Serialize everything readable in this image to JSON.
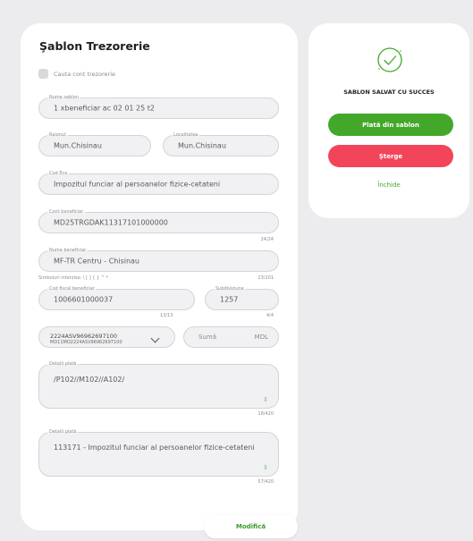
{
  "form": {
    "title": "Şablon Trezorerie",
    "checkbox_label": "Cauta cont trezorerie",
    "template_name": {
      "label": "Nume sablon",
      "value": "1 xbeneficiar ac 02 01 25 t2"
    },
    "raion": {
      "label": "Raionul",
      "value": "Mun.Chisinau"
    },
    "locality": {
      "label": "Localitatea",
      "value": "Mun.Chisinau"
    },
    "eco_code": {
      "label": "Cod Eco",
      "value": "Impozitul funciar al persoanelor fizice-cetateni"
    },
    "beneficiary_account": {
      "label": "Cont beneficiar",
      "value": "MD25TRGDAK11317101000000",
      "counter": "24/24"
    },
    "beneficiary_name": {
      "label": "Nume beneficiar",
      "value": "MF-TR Centru - Chisinau",
      "allowed_symbols": "Simboluri interzise: \\ [ ] { } ^ *",
      "counter": "23/101"
    },
    "fiscal_code": {
      "label": "Cod fiscal beneficiar",
      "value": "1006601000037",
      "counter": "13/13"
    },
    "subdivision": {
      "label": "Subdiviziune",
      "value": "1257",
      "counter": "4/4"
    },
    "payer_account": {
      "main": "2224ASV96962697100",
      "sub": "MD11MO2224ASV96962697100"
    },
    "amount": {
      "placeholder": "Sumă",
      "currency": "MDL"
    },
    "payment_details_1": {
      "label": "Detalii plată",
      "value": "/P102//M102//A102/",
      "counter": "18/420"
    },
    "payment_details_2": {
      "label": "Detalii plată",
      "value": "113171 - Impozitul funciar al persoanelor fizice-cetateni",
      "counter": "57/420"
    },
    "modify_label": "Modifică"
  },
  "success": {
    "title": "SABLON SALVAT CU SUCCES",
    "pay_label": "Plată din sablon",
    "delete_label": "Şterge",
    "close_label": "Închide"
  },
  "colors": {
    "green": "#43a82a",
    "red": "#f2455a",
    "background": "#ececee"
  },
  "icons": {
    "success": "check-circle-icon",
    "chevron": "chevron-down-icon",
    "resize": "resize-handle-icon"
  }
}
